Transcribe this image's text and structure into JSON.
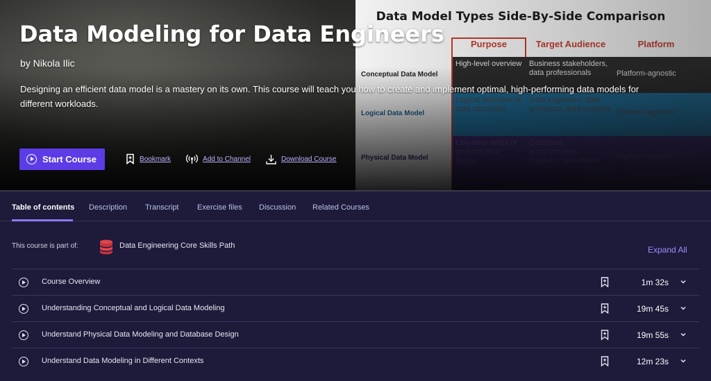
{
  "course": {
    "title": "Data Modeling for Data Engineers",
    "author": "by Nikola Ilic",
    "description": "Designing an efficient data model is a mastery on its own. This course will teach you how to create and implement optimal, high-performing data models for different workloads."
  },
  "actions": {
    "start_label": "Start Course",
    "bookmark_label": "Bookmark",
    "channel_label": "Add to Channel",
    "download_label": "Download Course"
  },
  "slide": {
    "title": "Data Model Types Side-By-Side Comparison",
    "headers": [
      "Purpose",
      "Target Audience",
      "Platform"
    ],
    "rows": [
      {
        "label": "Conceptual Data Model",
        "purpose": "High-level overview",
        "audience": "Business stakeholders, data professionals",
        "platform": "Platform-agnostic"
      },
      {
        "label": "Logical Data Model",
        "purpose": "Logical definition of data structures",
        "audience": "Data engineers, data architects, data analysts",
        "platform": "Platform-agnostic"
      },
      {
        "label": "Physical Data Model",
        "purpose": "Low-level detail of physical data design",
        "audience": "Database administrators, database developers",
        "platform": "Platform-specific"
      }
    ]
  },
  "tabs": [
    {
      "label": "Table of contents",
      "active": true
    },
    {
      "label": "Description",
      "active": false
    },
    {
      "label": "Transcript",
      "active": false
    },
    {
      "label": "Exercise files",
      "active": false
    },
    {
      "label": "Discussion",
      "active": false
    },
    {
      "label": "Related Courses",
      "active": false
    }
  ],
  "path": {
    "label": "This course is part of:",
    "name": "Data Engineering Core Skills Path"
  },
  "expand_all_label": "Expand All",
  "modules": [
    {
      "title": "Course Overview",
      "duration": "1m 32s"
    },
    {
      "title": "Understanding Conceptual and Logical Data Modeling",
      "duration": "19m 45s"
    },
    {
      "title": "Understand Physical Data Modeling and Database Design",
      "duration": "19m 55s"
    },
    {
      "title": "Understand Data Modeling in Different Contexts",
      "duration": "12m 23s"
    }
  ],
  "colors": {
    "accent": "#5c3ce6",
    "link": "#9d8dff",
    "background": "#1d1a3a",
    "slide_header": "#c0392b"
  }
}
